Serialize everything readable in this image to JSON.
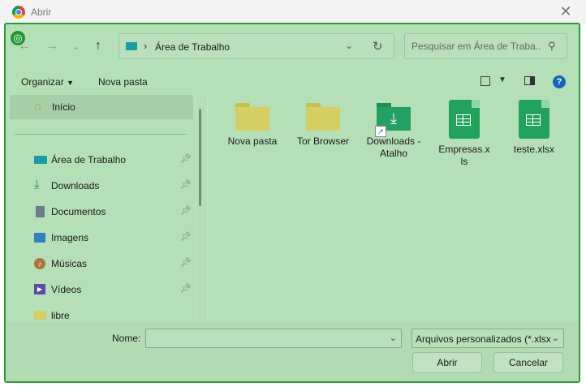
{
  "window": {
    "title": "Abrir"
  },
  "address": {
    "path": "Área de Trabalho"
  },
  "search": {
    "placeholder": "Pesquisar em Área de Traba..."
  },
  "toolbar": {
    "organize": "Organizar",
    "new_folder": "Nova pasta"
  },
  "sidebar": {
    "home": "Início",
    "items": [
      {
        "label": "Área de Trabalho",
        "icon": "desktop-icon",
        "pinned": true
      },
      {
        "label": "Downloads",
        "icon": "download-icon",
        "pinned": true
      },
      {
        "label": "Documentos",
        "icon": "document-icon",
        "pinned": true
      },
      {
        "label": "Imagens",
        "icon": "image-icon",
        "pinned": true
      },
      {
        "label": "Músicas",
        "icon": "music-icon",
        "pinned": true
      },
      {
        "label": "Vídeos",
        "icon": "video-icon",
        "pinned": true
      },
      {
        "label": "libre",
        "icon": "folder-icon",
        "pinned": false
      }
    ]
  },
  "files": [
    {
      "name": "Nova pasta",
      "type": "folder"
    },
    {
      "name": "Tor Browser",
      "type": "folder"
    },
    {
      "name": "Downloads - Atalho",
      "type": "shortcut"
    },
    {
      "name": "Empresas.xls",
      "type": "excel"
    },
    {
      "name": "teste.xlsx",
      "type": "excel"
    }
  ],
  "footer": {
    "name_label": "Nome:",
    "name_value": "",
    "filter": "Arquivos personalizados (*.xlsx;",
    "open_button": "Abrir",
    "cancel_button": "Cancelar"
  },
  "colors": {
    "overlay": "#b5dfb6",
    "overlay_border": "#2e9b3a",
    "excel": "#21a35b",
    "folder": "#d5cf63"
  }
}
